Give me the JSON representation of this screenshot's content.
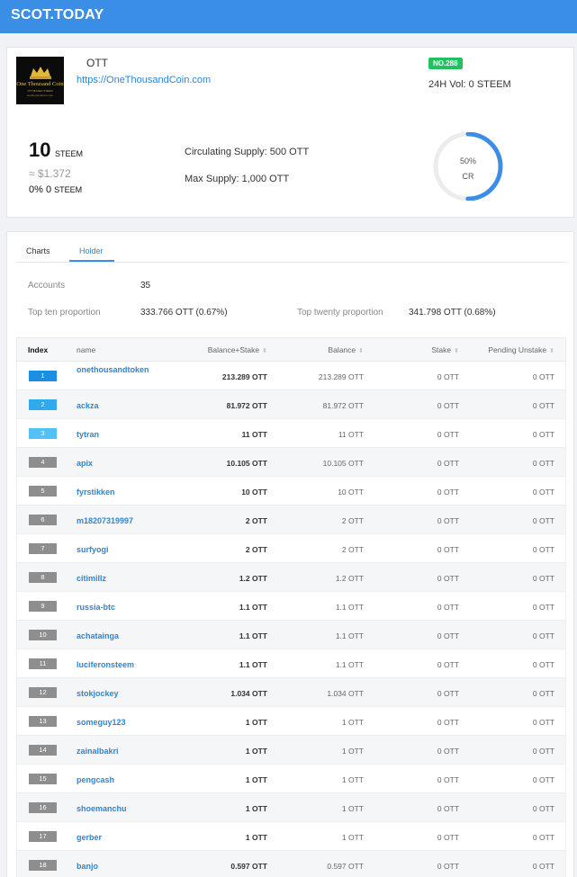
{
  "header": {
    "brand": "SCOT.TODAY"
  },
  "token": {
    "logo_text": "One Thousand Coin",
    "logo_sub1": "OTT BASED STEEM",
    "logo_sub2": "onethousandcoin.com",
    "symbol": "OTT",
    "website": "https://OneThousandCoin.com",
    "rank": "NO.288",
    "volume": "24H Vol: 0 STEEM",
    "price": "10",
    "price_unit": "STEEM",
    "usd_price": "≈ $1.372",
    "change": "0% 0",
    "change_unit": "STEEM",
    "circulating_supply": "Circulating Supply:  500 OTT",
    "max_supply": "Max Supply:  1,000 OTT",
    "cr_percent": "50%",
    "cr_value": 0.5,
    "cr_label": "CR"
  },
  "colors": {
    "accent": "#3a8ee6",
    "rank_badge": "#21c25e",
    "gauge_track": "#ececec"
  },
  "tabs": [
    {
      "label": "Charts",
      "active": false
    },
    {
      "label": "Holder",
      "active": true
    }
  ],
  "stats": {
    "accounts_label": "Accounts",
    "accounts_value": "35",
    "top_ten_label": "Top ten proportion",
    "top_ten_value": "333.766 OTT (0.67%)",
    "top_twenty_label": "Top twenty proportion",
    "top_twenty_value": "341.798 OTT (0.68%)"
  },
  "table": {
    "columns": [
      "Index",
      "name",
      "Balance+Stake",
      "Balance",
      "Stake",
      "Pending Unstake"
    ],
    "sort_icon": "sort-icon",
    "rows": [
      {
        "index": "1",
        "name": "onethousandtoken",
        "balance_stake": "213.289 OTT",
        "balance": "213.289 OTT",
        "stake": "0 OTT",
        "pending": "0 OTT",
        "badge": "#1a8fe3"
      },
      {
        "index": "2",
        "name": "ackza",
        "balance_stake": "81.972 OTT",
        "balance": "81.972 OTT",
        "stake": "0 OTT",
        "pending": "0 OTT",
        "badge": "#32a8ee"
      },
      {
        "index": "3",
        "name": "tytran",
        "balance_stake": "11 OTT",
        "balance": "11 OTT",
        "stake": "0 OTT",
        "pending": "0 OTT",
        "badge": "#52c1f6"
      },
      {
        "index": "4",
        "name": "apix",
        "balance_stake": "10.105 OTT",
        "balance": "10.105 OTT",
        "stake": "0 OTT",
        "pending": "0 OTT",
        "badge": "#8e8e8e"
      },
      {
        "index": "5",
        "name": "fyrstikken",
        "balance_stake": "10 OTT",
        "balance": "10 OTT",
        "stake": "0 OTT",
        "pending": "0 OTT",
        "badge": "#8e8e8e"
      },
      {
        "index": "6",
        "name": "m18207319997",
        "balance_stake": "2 OTT",
        "balance": "2 OTT",
        "stake": "0 OTT",
        "pending": "0 OTT",
        "badge": "#8e8e8e"
      },
      {
        "index": "7",
        "name": "surfyogi",
        "balance_stake": "2 OTT",
        "balance": "2 OTT",
        "stake": "0 OTT",
        "pending": "0 OTT",
        "badge": "#8e8e8e"
      },
      {
        "index": "8",
        "name": "citimillz",
        "balance_stake": "1.2 OTT",
        "balance": "1.2 OTT",
        "stake": "0 OTT",
        "pending": "0 OTT",
        "badge": "#8e8e8e"
      },
      {
        "index": "9",
        "name": "russia-btc",
        "balance_stake": "1.1 OTT",
        "balance": "1.1 OTT",
        "stake": "0 OTT",
        "pending": "0 OTT",
        "badge": "#8e8e8e"
      },
      {
        "index": "10",
        "name": "achatainga",
        "balance_stake": "1.1 OTT",
        "balance": "1.1 OTT",
        "stake": "0 OTT",
        "pending": "0 OTT",
        "badge": "#8e8e8e"
      },
      {
        "index": "11",
        "name": "luciferonsteem",
        "balance_stake": "1.1 OTT",
        "balance": "1.1 OTT",
        "stake": "0 OTT",
        "pending": "0 OTT",
        "badge": "#8e8e8e"
      },
      {
        "index": "12",
        "name": "stokjockey",
        "balance_stake": "1.034 OTT",
        "balance": "1.034 OTT",
        "stake": "0 OTT",
        "pending": "0 OTT",
        "badge": "#8e8e8e"
      },
      {
        "index": "13",
        "name": "someguy123",
        "balance_stake": "1 OTT",
        "balance": "1 OTT",
        "stake": "0 OTT",
        "pending": "0 OTT",
        "badge": "#8e8e8e"
      },
      {
        "index": "14",
        "name": "zainalbakri",
        "balance_stake": "1 OTT",
        "balance": "1 OTT",
        "stake": "0 OTT",
        "pending": "0 OTT",
        "badge": "#8e8e8e"
      },
      {
        "index": "15",
        "name": "pengcash",
        "balance_stake": "1 OTT",
        "balance": "1 OTT",
        "stake": "0 OTT",
        "pending": "0 OTT",
        "badge": "#8e8e8e"
      },
      {
        "index": "16",
        "name": "shoemanchu",
        "balance_stake": "1 OTT",
        "balance": "1 OTT",
        "stake": "0 OTT",
        "pending": "0 OTT",
        "badge": "#8e8e8e"
      },
      {
        "index": "17",
        "name": "gerber",
        "balance_stake": "1 OTT",
        "balance": "1 OTT",
        "stake": "0 OTT",
        "pending": "0 OTT",
        "badge": "#8e8e8e"
      },
      {
        "index": "18",
        "name": "banjo",
        "balance_stake": "0.597 OTT",
        "balance": "0.597 OTT",
        "stake": "0 OTT",
        "pending": "0 OTT",
        "badge": "#8e8e8e"
      }
    ]
  }
}
